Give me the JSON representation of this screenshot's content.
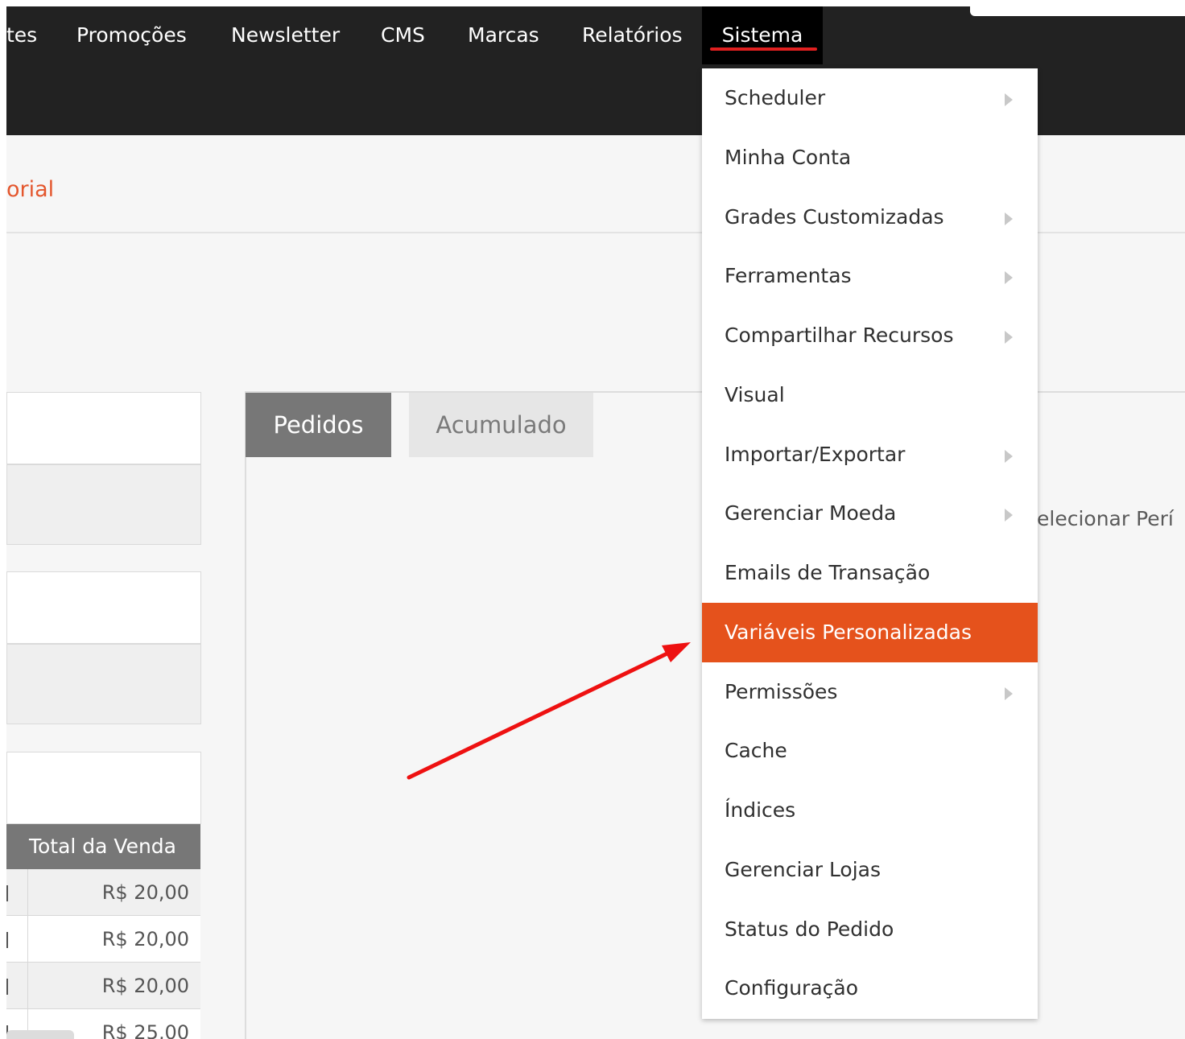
{
  "nav": {
    "items": [
      {
        "label": "tes"
      },
      {
        "label": "Promoções"
      },
      {
        "label": "Newsletter"
      },
      {
        "label": "CMS"
      },
      {
        "label": "Marcas"
      },
      {
        "label": "Relatórios"
      },
      {
        "label": "Sistema"
      }
    ]
  },
  "breadcrumb": "orial",
  "dashboard": {
    "tabs": [
      {
        "label": "Pedidos"
      },
      {
        "label": "Acumulado"
      }
    ],
    "period_label": "elecionar Perí"
  },
  "table": {
    "header": "Total da Venda",
    "rows": [
      {
        "value": "R$ 20,00"
      },
      {
        "value": "R$ 20,00"
      },
      {
        "value": "R$ 20,00"
      },
      {
        "value": "R$ 25,00"
      }
    ]
  },
  "menu": {
    "items": [
      {
        "label": "Scheduler",
        "submenu": true
      },
      {
        "label": "Minha Conta",
        "submenu": false
      },
      {
        "label": "Grades Customizadas",
        "submenu": true
      },
      {
        "label": "Ferramentas",
        "submenu": true
      },
      {
        "label": "Compartilhar Recursos",
        "submenu": true
      },
      {
        "label": "Visual",
        "submenu": false
      },
      {
        "label": "Importar/Exportar",
        "submenu": true
      },
      {
        "label": "Gerenciar Moeda",
        "submenu": true
      },
      {
        "label": "Emails de Transação",
        "submenu": false
      },
      {
        "label": "Variáveis Personalizadas",
        "submenu": false,
        "highlighted": true
      },
      {
        "label": "Permissões",
        "submenu": true
      },
      {
        "label": "Cache",
        "submenu": false
      },
      {
        "label": "Índices",
        "submenu": false
      },
      {
        "label": "Gerenciar Lojas",
        "submenu": false
      },
      {
        "label": "Status do Pedido",
        "submenu": false
      },
      {
        "label": "Configuração",
        "submenu": false
      }
    ]
  },
  "colors": {
    "header_bg": "#222222",
    "accent": "#e5521c",
    "active_underline": "#e02020",
    "annotation_arrow": "#ee1111"
  }
}
